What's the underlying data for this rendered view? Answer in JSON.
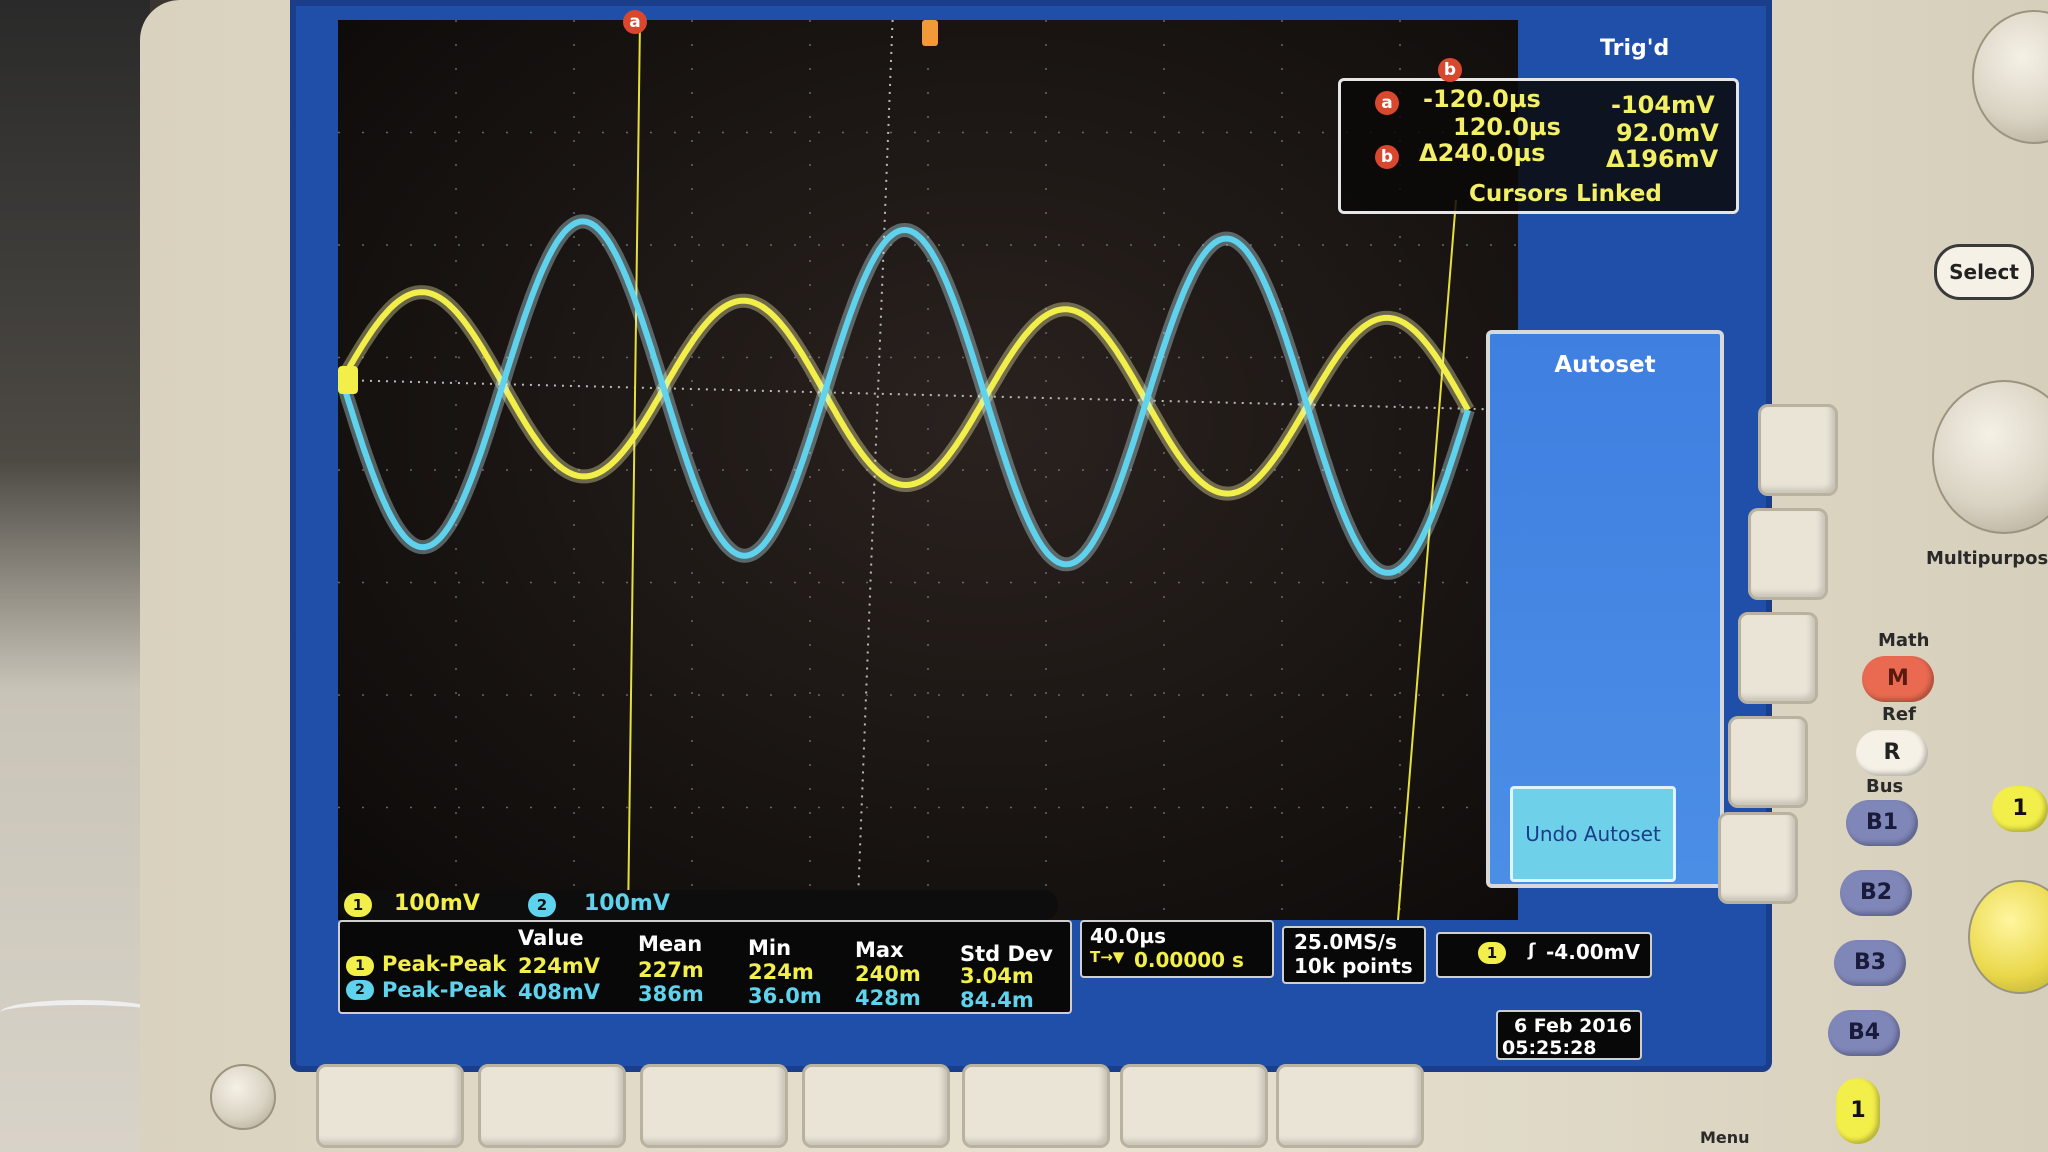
{
  "trigger_status": "Trig'd",
  "cursor_readout": {
    "a_label": "a",
    "b_label": "b",
    "a_time": "-120.0µs",
    "a_volt": "-104mV",
    "b_time": "120.0µs",
    "b_volt": "92.0mV",
    "delta_time": "Δ240.0µs",
    "delta_volt": "Δ196mV",
    "linked_text": "Cursors Linked"
  },
  "menu": {
    "title": "Autoset",
    "undo_button": "Undo Autoset"
  },
  "channel_scales": [
    {
      "channel": "1",
      "scale": "100mV",
      "color": "#f2ee4a"
    },
    {
      "channel": "2",
      "scale": "100mV",
      "color": "#5fd3ee"
    }
  ],
  "measurements": {
    "headers": [
      "Value",
      "Mean",
      "Min",
      "Max",
      "Std Dev"
    ],
    "rows": [
      {
        "channel": "1",
        "name": "Peak-Peak",
        "value": "224mV",
        "mean": "227m",
        "min": "224m",
        "max": "240m",
        "std_dev": "3.04m",
        "color": "#f2ee4a"
      },
      {
        "channel": "2",
        "name": "Peak-Peak",
        "value": "408mV",
        "mean": "386m",
        "min": "36.0m",
        "max": "428m",
        "std_dev": "84.4m",
        "color": "#5fd3ee"
      }
    ]
  },
  "timebase": {
    "scale": "40.0µs",
    "position": "0.00000 s"
  },
  "acquisition": {
    "rate": "25.0MS/s",
    "record": "10k points"
  },
  "trigger": {
    "channel": "1",
    "level": "-4.00mV"
  },
  "datetime": {
    "date": "6 Feb 2016",
    "time": "05:25:28"
  },
  "front_panel": {
    "select_label": "Select",
    "multipurpose_label": "Multipurpose",
    "math_label": "Math",
    "math_key": "M",
    "ref_label": "Ref",
    "ref_key": "R",
    "bus_label": "Bus",
    "bus_keys": [
      "B1",
      "B2",
      "B3",
      "B4"
    ],
    "menu_label": "Menu",
    "channel_key": "1"
  },
  "colors": {
    "ch1_trace": "#f2ee4a",
    "ch2_trace": "#5fd3ee",
    "screen_frame": "#1f4fa8",
    "cursor_badge": "#d8472e"
  }
}
